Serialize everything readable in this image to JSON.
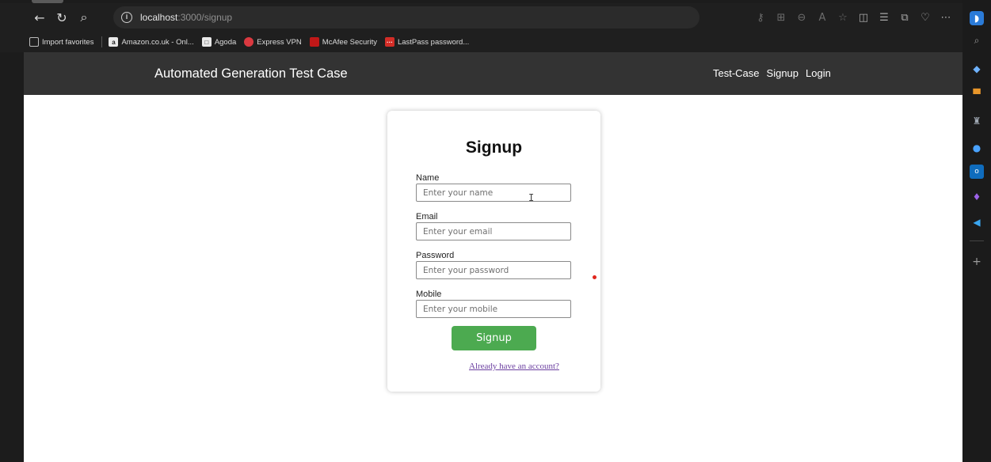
{
  "browser": {
    "url_host": "localhost",
    "url_path": ":3000/signup",
    "favorites": [
      {
        "label": "Import favorites",
        "icon": "import-favorites-icon",
        "color": "#3a3a3a"
      },
      {
        "label": "Amazon.co.uk - Onl...",
        "icon": "amazon-icon",
        "color": "#3a3a3a"
      },
      {
        "label": "Agoda",
        "icon": "agoda-icon",
        "color": "#3a3a3a"
      },
      {
        "label": "Express VPN",
        "icon": "expressvpn-icon",
        "color": "#da3940"
      },
      {
        "label": "McAfee Security",
        "icon": "mcafee-icon",
        "color": "#c01818"
      },
      {
        "label": "LastPass password...",
        "icon": "lastpass-icon",
        "color": "#d32d27"
      }
    ]
  },
  "site": {
    "brand": "Automated Generation Test Case",
    "nav": [
      "Test-Case",
      "Signup",
      "Login"
    ]
  },
  "form": {
    "title": "Signup",
    "fields": [
      {
        "label": "Name",
        "placeholder": "Enter your name"
      },
      {
        "label": "Email",
        "placeholder": "Enter your email"
      },
      {
        "label": "Password",
        "placeholder": "Enter your password"
      },
      {
        "label": "Mobile",
        "placeholder": "Enter your mobile"
      }
    ],
    "submit_label": "Signup",
    "account_link": "Already have an account?"
  },
  "colors": {
    "navbar": "#333333",
    "button": "#4caa50",
    "link": "#6b3fa0"
  }
}
